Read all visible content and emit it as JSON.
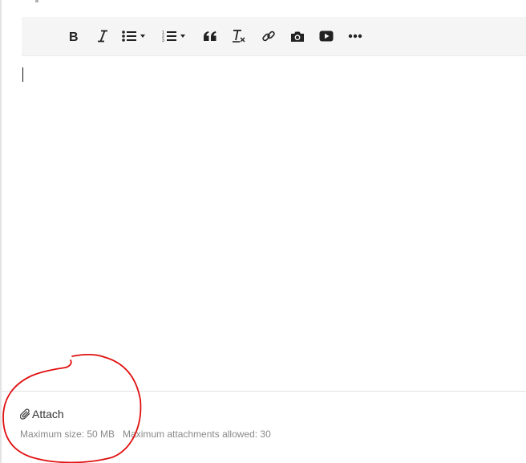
{
  "toolbar": {
    "buttons": [
      {
        "name": "bold-button",
        "icon": "bold-icon"
      },
      {
        "name": "italic-button",
        "icon": "italic-icon"
      },
      {
        "name": "bulleted-list-button",
        "icon": "bulleted-list-icon",
        "dropdown": true
      },
      {
        "name": "numbered-list-button",
        "icon": "numbered-list-icon",
        "dropdown": true
      },
      {
        "name": "blockquote-button",
        "icon": "quote-icon"
      },
      {
        "name": "clear-formatting-button",
        "icon": "clear-format-icon"
      },
      {
        "name": "link-button",
        "icon": "link-icon"
      },
      {
        "name": "image-button",
        "icon": "camera-icon"
      },
      {
        "name": "video-button",
        "icon": "video-play-icon"
      },
      {
        "name": "more-button",
        "icon": "ellipsis-icon"
      }
    ]
  },
  "editor": {
    "content": ""
  },
  "attachments": {
    "label": "Attach",
    "icon": "paperclip-icon",
    "max_size": "Maximum size: 50 MB",
    "max_count": "Maximum attachments allowed: 30"
  },
  "annotation": {
    "color": "#e01010",
    "shape": "hand-drawn-circle"
  }
}
